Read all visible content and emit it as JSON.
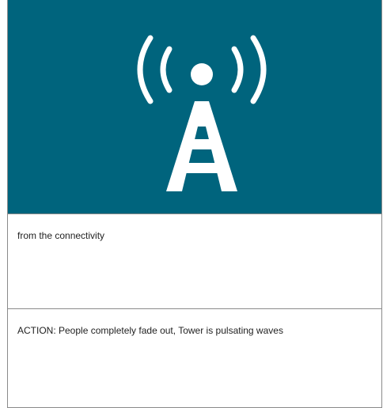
{
  "illustration": {
    "background_color": "#00647d",
    "foreground_color": "#ffffff",
    "icon": "radio-tower-icon"
  },
  "caption": {
    "text": "from the connectivity"
  },
  "action": {
    "text": "ACTION:  People completely fade out, Tower is pulsating waves"
  }
}
